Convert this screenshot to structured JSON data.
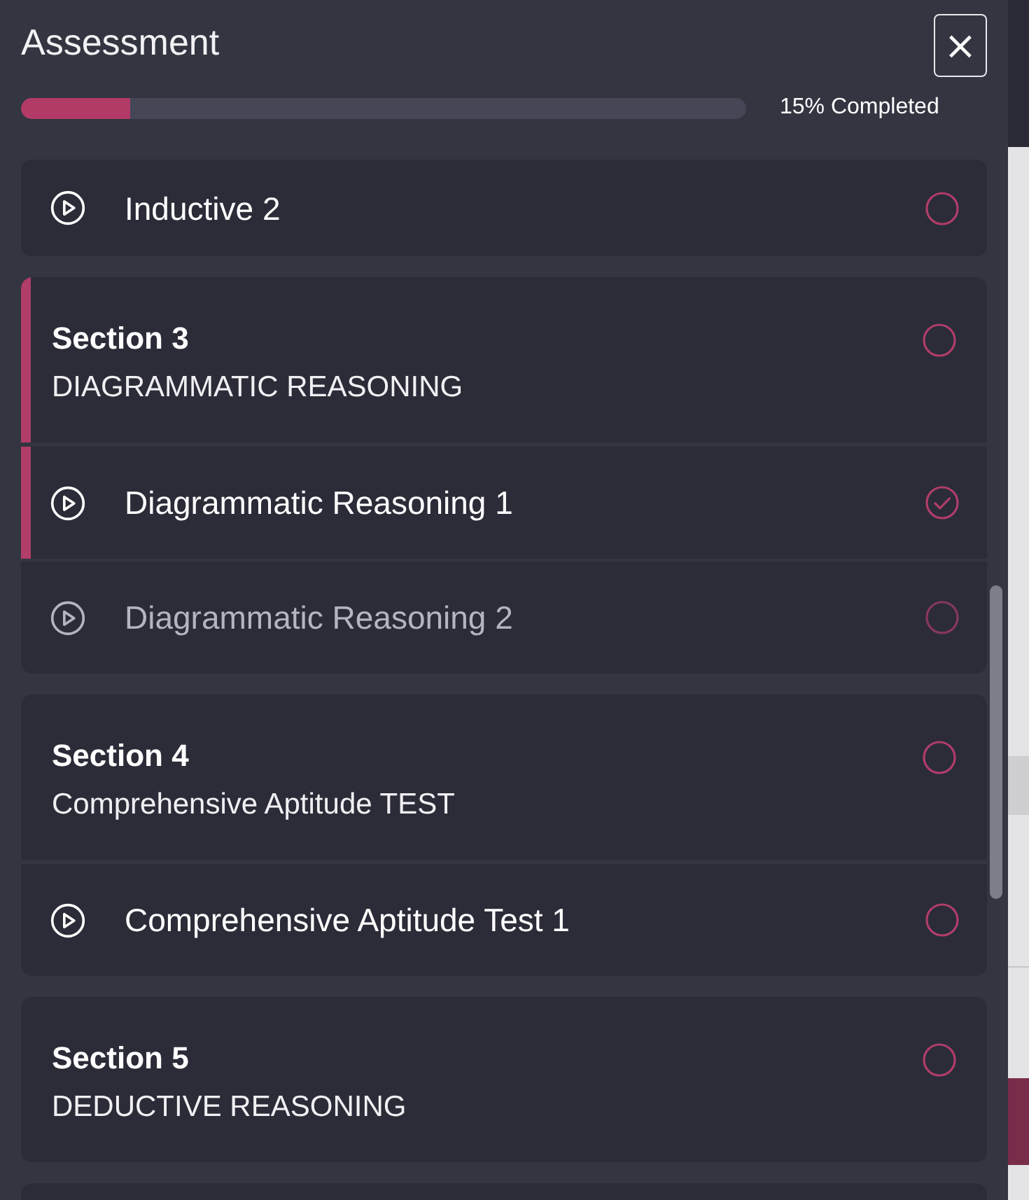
{
  "panel": {
    "title": "Assessment",
    "close": "×"
  },
  "progress": {
    "level": 0.15,
    "label": "15% Completed"
  },
  "cards": [
    {
      "items": [
        {
          "label": "Inductive 2",
          "active": false,
          "completed": false,
          "disabled": false
        }
      ]
    },
    {
      "section": {
        "title": "Section 3",
        "subtitle": "DIAGRAMMATIC REASONING",
        "active": true,
        "completed": false
      },
      "items": [
        {
          "label": "Diagrammatic Reasoning 1",
          "active": true,
          "completed": true,
          "disabled": false
        },
        {
          "label": "Diagrammatic Reasoning 2",
          "active": false,
          "completed": false,
          "disabled": true
        }
      ]
    },
    {
      "section": {
        "title": "Section 4",
        "subtitle": "Comprehensive Aptitude TEST",
        "active": false,
        "completed": false
      },
      "items": [
        {
          "label": "Comprehensive Aptitude Test 1",
          "active": false,
          "completed": false,
          "disabled": false
        }
      ]
    },
    {
      "section": {
        "title": "Section 5",
        "subtitle": "DEDUCTIVE REASONING",
        "active": false,
        "completed": false
      }
    }
  ]
}
